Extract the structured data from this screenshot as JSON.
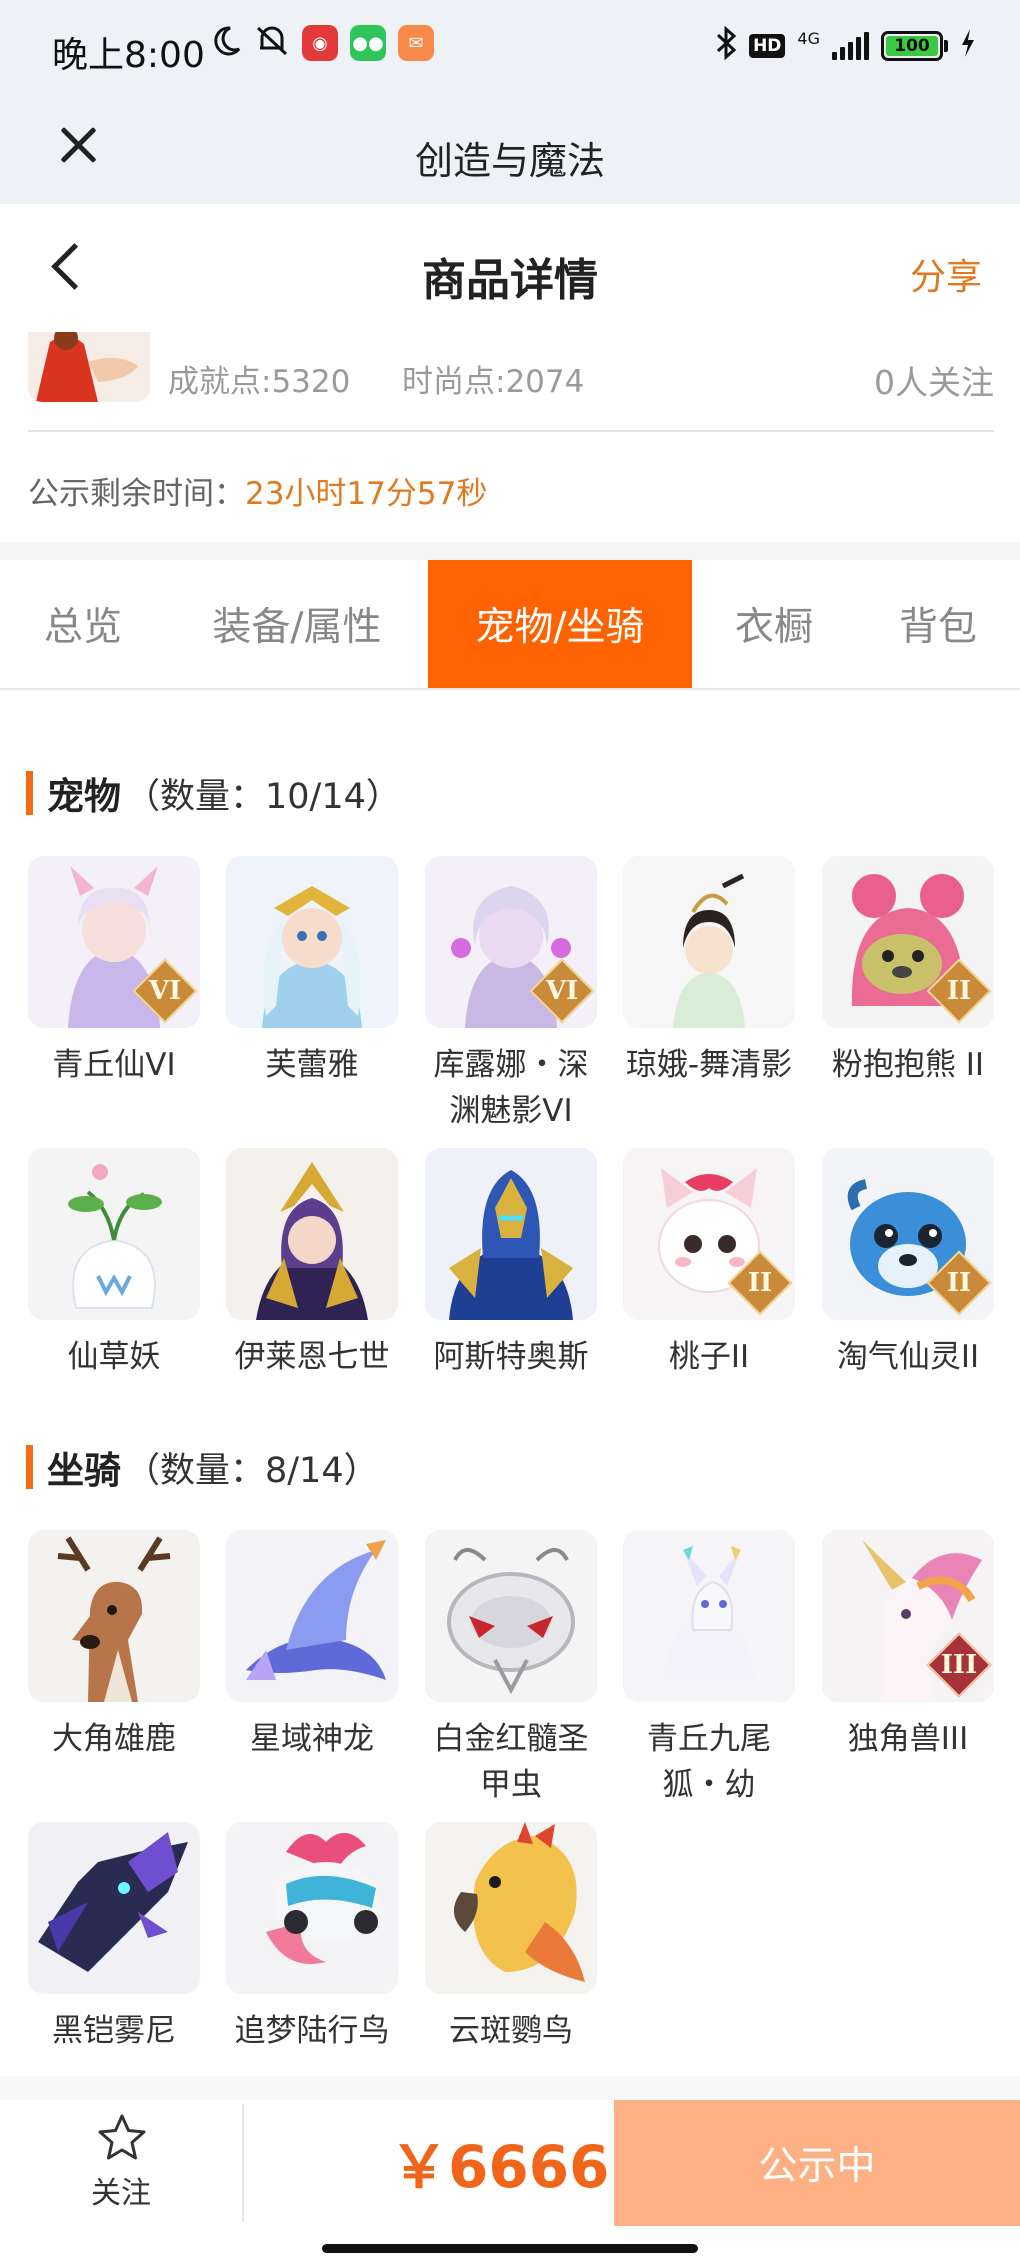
{
  "status_bar": {
    "time": "晚上8:00",
    "network": "4G",
    "hd": "HD",
    "battery": "100",
    "app_icons": [
      "moon-icon",
      "mute-icon",
      "netease-music-icon",
      "wechat-icon",
      "mail-app-icon"
    ]
  },
  "app_bar": {
    "title": "创造与魔法"
  },
  "header": {
    "title": "商品详情",
    "share": "分享"
  },
  "seller": {
    "achievement": "成就点:5320",
    "fashion": "时尚点:2074",
    "followers": "0人关注",
    "countdown_label": "公示剩余时间：",
    "countdown_value": "23小时17分57秒"
  },
  "tabs": [
    {
      "label": "总览",
      "active": false
    },
    {
      "label": "装备/属性",
      "active": false
    },
    {
      "label": "宠物/坐骑",
      "active": true
    },
    {
      "label": "衣橱",
      "active": false
    },
    {
      "label": "背包",
      "active": false
    }
  ],
  "pets": {
    "title": "宠物",
    "count": "（数量：10/14）",
    "items": [
      {
        "name": "青丘仙VI",
        "badge": "VI"
      },
      {
        "name": "芙蕾雅",
        "badge": ""
      },
      {
        "name": "库露娜・深渊魅影VI",
        "badge": "VI"
      },
      {
        "name": "琼娥-舞清影",
        "badge": ""
      },
      {
        "name": "粉抱抱熊 II",
        "badge": "II"
      },
      {
        "name": "仙草妖",
        "badge": ""
      },
      {
        "name": "伊莱恩七世",
        "badge": ""
      },
      {
        "name": "阿斯特奥斯",
        "badge": ""
      },
      {
        "name": "桃子II",
        "badge": "II"
      },
      {
        "name": "淘气仙灵II",
        "badge": "II"
      }
    ]
  },
  "mounts": {
    "title": "坐骑",
    "count": "（数量：8/14）",
    "items": [
      {
        "name": "大角雄鹿",
        "badge": ""
      },
      {
        "name": "星域神龙",
        "badge": ""
      },
      {
        "name": "白金红髓圣甲虫",
        "badge": ""
      },
      {
        "name": "青丘九尾狐・幼",
        "badge": ""
      },
      {
        "name": "独角兽III",
        "badge": "III"
      },
      {
        "name": "黑铠雾尼",
        "badge": ""
      },
      {
        "name": "追梦陆行鸟",
        "badge": ""
      },
      {
        "name": "云斑鹦鸟",
        "badge": ""
      }
    ]
  },
  "bottom_bar": {
    "follow_label": "关注",
    "price": "￥6666",
    "cta": "公示中"
  }
}
